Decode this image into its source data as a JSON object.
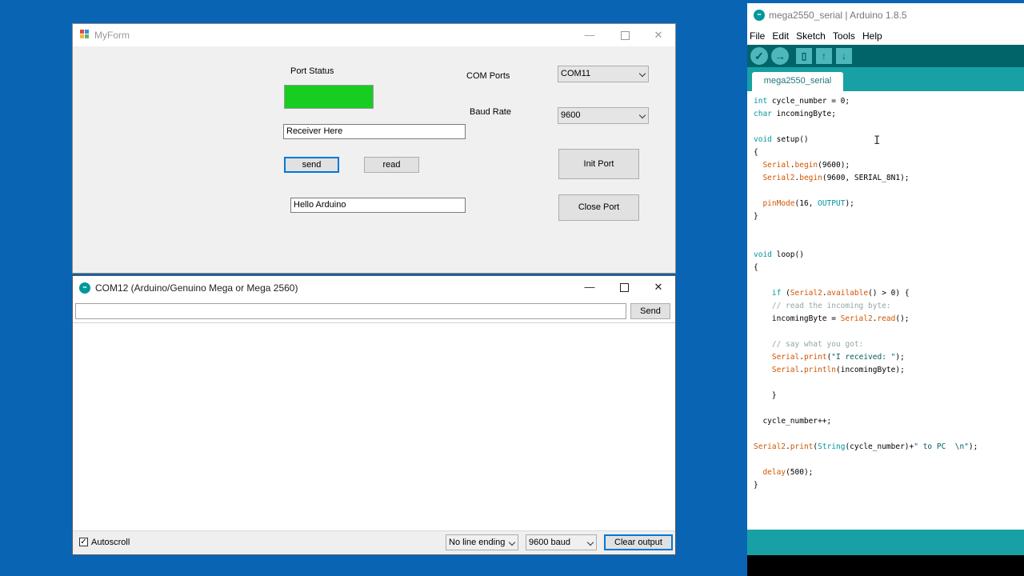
{
  "myform": {
    "title": "MyForm",
    "minimize": "—",
    "close": "✕",
    "port_status_label": "Port Status",
    "port_status_color": "#17cd22",
    "com_ports_label": "COM Ports",
    "com_ports_value": "COM11",
    "baud_rate_label": "Baud Rate",
    "baud_rate_value": "9600",
    "receiver_text": "Receiver Here",
    "send_label": "send",
    "read_label": "read",
    "init_port_label": "Init Port",
    "close_port_label": "Close Port",
    "message_text": "Hello Arduino"
  },
  "serial_monitor": {
    "title": "COM12 (Arduino/Genuino Mega or Mega 2560)",
    "icon": "arduino-icon",
    "minimize": "—",
    "close": "✕",
    "send_label": "Send",
    "autoscroll_label": "Autoscroll",
    "autoscroll_checked": true,
    "line_ending": "No line ending",
    "baud": "9600 baud",
    "clear_label": "Clear output"
  },
  "ide": {
    "title": "mega2550_serial | Arduino 1.8.5",
    "menu": [
      "File",
      "Edit",
      "Sketch",
      "Tools",
      "Help"
    ],
    "toolbar_icons": [
      "verify-icon",
      "upload-icon",
      "new-icon",
      "open-icon",
      "save-icon"
    ],
    "tab_label": "mega2550_serial",
    "accent": "#17a1a5",
    "code_lines": [
      "int cycle_number = 0;",
      "char incomingByte;",
      "",
      "void setup()",
      "{",
      "  Serial.begin(9600);",
      "  Serial2.begin(9600, SERIAL_8N1);",
      "",
      "  pinMode(16, OUTPUT);",
      "}",
      "",
      "",
      "void loop()",
      "{",
      "",
      "    if (Serial2.available() > 0) {",
      "    // read the incoming byte:",
      "    incomingByte = Serial2.read();",
      "",
      "    // say what you got:",
      "    Serial.print(\"I received: \");",
      "    Serial.println(incomingByte);",
      "",
      "    }",
      "",
      "  cycle_number++;",
      "",
      "Serial2.print(String(cycle_number)+\" to PC  \\n\");",
      "",
      "  delay(500);",
      "}"
    ]
  }
}
